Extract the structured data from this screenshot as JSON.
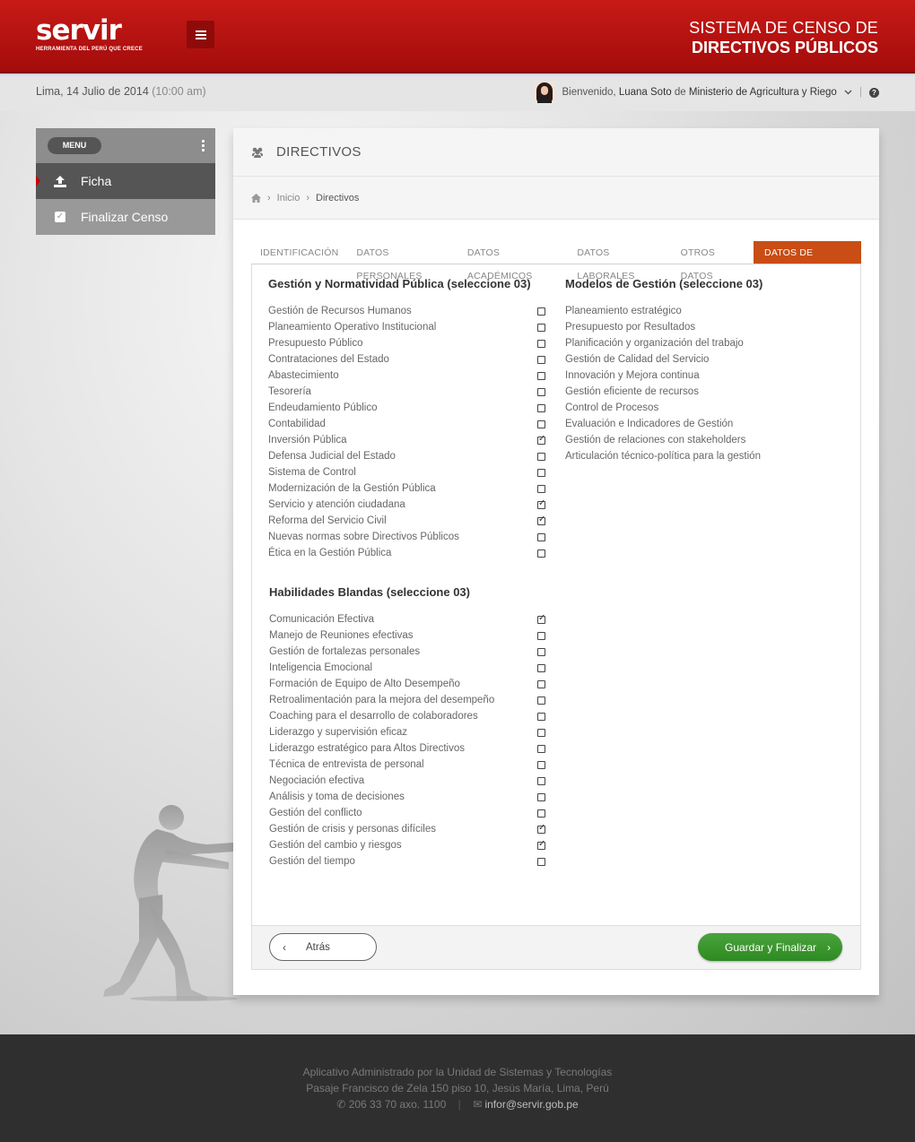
{
  "header": {
    "logo_text": "servir",
    "logo_tagline": "HERRAMIENTA DEL PERÚ QUE CRECE",
    "system_title_line1": "SISTEMA DE CENSO  DE",
    "system_title_line2": "DIRECTIVOS PÚBLICOS"
  },
  "infobar": {
    "date": "Lima, 14 Julio de 2014",
    "time": "(10:00 am)",
    "welcome": "Bienvenido,",
    "user_name": "Luana Soto",
    "de": "de",
    "institution": "Ministerio de Agricultura y Riego"
  },
  "sidebar": {
    "menu_label": "MENU",
    "items": [
      {
        "label": "Ficha",
        "icon": "upload-icon"
      },
      {
        "label": "Finalizar Censo",
        "icon": "check-square-icon"
      }
    ]
  },
  "panel": {
    "title": "DIRECTIVOS",
    "breadcrumb": {
      "home": "Inicio",
      "current": "Directivos"
    }
  },
  "tabs": [
    "IDENTIFICACIÓN",
    "DATOS PERSONALES",
    "DATOS ACADÉMICOS",
    "DATOS LABORALES",
    "OTROS DATOS",
    "DATOS DE INTERÉS"
  ],
  "active_tab": "DATOS DE INTERÉS",
  "sections": {
    "gestion": {
      "title": "Gestión y Normatividad Pública (seleccione 03)",
      "options": [
        {
          "label": "Gestión de Recursos Humanos",
          "checked": false
        },
        {
          "label": "Planeamiento Operativo Institucional",
          "checked": false
        },
        {
          "label": "Presupuesto Público",
          "checked": false
        },
        {
          "label": "Contrataciones del Estado",
          "checked": false
        },
        {
          "label": "Abastecimiento",
          "checked": false
        },
        {
          "label": "Tesorería",
          "checked": false
        },
        {
          "label": "Endeudamiento Público",
          "checked": false
        },
        {
          "label": "Contabilidad",
          "checked": false
        },
        {
          "label": "Inversión Pública",
          "checked": true
        },
        {
          "label": "Defensa Judicial del Estado",
          "checked": false
        },
        {
          "label": "Sistema de Control",
          "checked": false
        },
        {
          "label": "Modernización de la Gestión Pública",
          "checked": false
        },
        {
          "label": "Servicio y atención ciudadana",
          "checked": true
        },
        {
          "label": "Reforma del Servicio Civil",
          "checked": true
        },
        {
          "label": "Nuevas normas sobre Directivos Públicos",
          "checked": false
        },
        {
          "label": "Ética en la Gestión Pública",
          "checked": false
        }
      ]
    },
    "modelos": {
      "title": "Modelos de Gestión (seleccione 03)",
      "options": [
        {
          "label": "Planeamiento estratégico"
        },
        {
          "label": "Presupuesto por Resultados"
        },
        {
          "label": "Planificación y organización del trabajo"
        },
        {
          "label": "Gestión de Calidad del Servicio"
        },
        {
          "label": "Innovación y Mejora continua"
        },
        {
          "label": "Gestión eficiente de recursos"
        },
        {
          "label": "Control de Procesos"
        },
        {
          "label": "Evaluación e Indicadores de Gestión"
        },
        {
          "label": "Gestión de relaciones con stakeholders"
        },
        {
          "label": "Articulación técnico-política para la gestión"
        }
      ]
    },
    "habilidades": {
      "title": "Habilidades Blandas (seleccione 03)",
      "options": [
        {
          "label": "Comunicación Efectiva",
          "checked": true
        },
        {
          "label": "Manejo de Reuniones efectivas",
          "checked": false
        },
        {
          "label": "Gestión de fortalezas personales",
          "checked": false
        },
        {
          "label": "Inteligencia Emocional",
          "checked": false
        },
        {
          "label": "Formación de Equipo de Alto Desempeño",
          "checked": false
        },
        {
          "label": "Retroalimentación para la mejora del desempeño",
          "checked": false
        },
        {
          "label": "Coaching para el desarrollo de colaboradores",
          "checked": false
        },
        {
          "label": "Liderazgo y supervisión eficaz",
          "checked": false
        },
        {
          "label": "Liderazgo estratégico para Altos Directivos",
          "checked": false
        },
        {
          "label": "Técnica de entrevista de personal",
          "checked": false
        },
        {
          "label": "Negociación efectiva",
          "checked": false
        },
        {
          "label": "Análisis y toma de decisiones",
          "checked": false
        },
        {
          "label": "Gestión del conflicto",
          "checked": false
        },
        {
          "label": "Gestión de crisis y personas difíciles",
          "checked": true
        },
        {
          "label": "Gestión del cambio y riesgos",
          "checked": true
        },
        {
          "label": "Gestión del tiempo",
          "checked": false
        }
      ]
    }
  },
  "buttons": {
    "back": "Atrás",
    "save": "Guardar y Finalizar"
  },
  "footer": {
    "line1": "Aplicativo Administrado por la Unidad de Sistemas y Tecnologías",
    "line2": "Pasaje Francisco de Zela 150 piso 10, Jesús María, Lima, Perú",
    "phone": "206 33 70 axo. 1100",
    "email": "infor@servir.gob.pe"
  },
  "colors": {
    "header_red": "#b5100f",
    "active_tab": "#c94d14",
    "save_green": "#3a9a2e"
  }
}
